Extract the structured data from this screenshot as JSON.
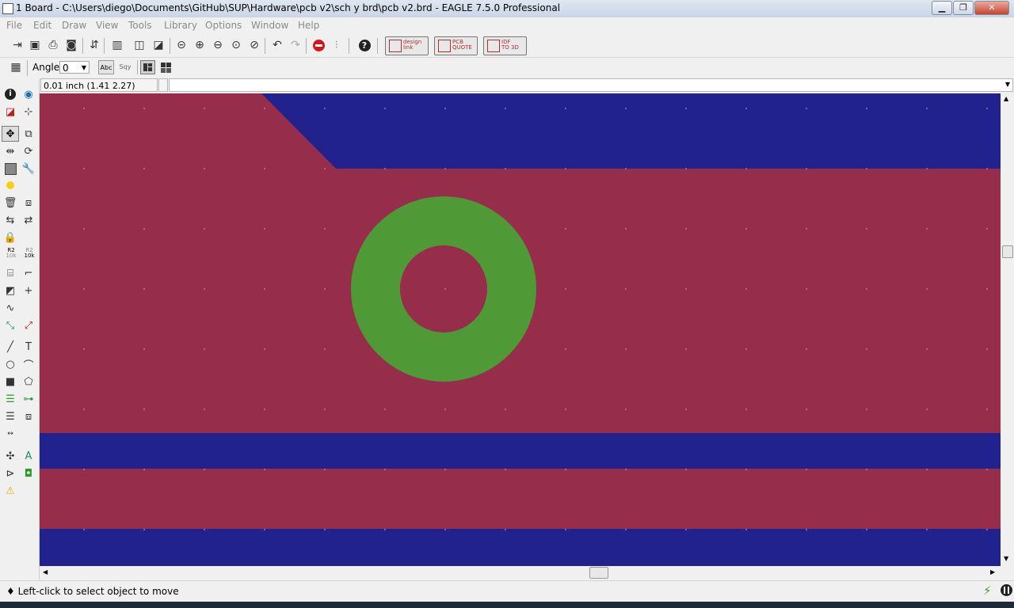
{
  "window": {
    "title": "1 Board - C:\\Users\\diego\\Documents\\GitHub\\SUP\\Hardware\\pcb v2\\sch y brd\\pcb v2.brd - EAGLE 7.5.0 Professional",
    "minimize_symbol": "▁",
    "maximize_symbol": "❐",
    "close_symbol": "✕"
  },
  "menu": [
    "File",
    "Edit",
    "Draw",
    "View",
    "Tools",
    "Library",
    "Options",
    "Window",
    "Help"
  ],
  "toolbar": {
    "extensions": [
      {
        "line1": "design",
        "line2": "link",
        "icon": "designlink-icon"
      },
      {
        "line1": "PCB",
        "line2": "QUOTE",
        "icon": "pcb-quote-icon"
      },
      {
        "line1": "IDF",
        "line2": "TO 3D",
        "icon": "idf-to-3d-icon"
      }
    ]
  },
  "params": {
    "angle_label": "Angle:",
    "angle_value": "0",
    "abc_label": "Abc",
    "sqy_label": "Sqy"
  },
  "coordinates": {
    "display": "0.01 inch (1.41 2.27)"
  },
  "palette": {
    "r2_10k_top": "R2",
    "r2_10k_bottom": "10k"
  },
  "status": {
    "message": "♦ Left-click to select object to move"
  },
  "colors": {
    "top_copper": "#962d4b",
    "bottom_copper": "#22228f",
    "pad": "#4f9a36",
    "grid_dot": "#c08aa0"
  }
}
